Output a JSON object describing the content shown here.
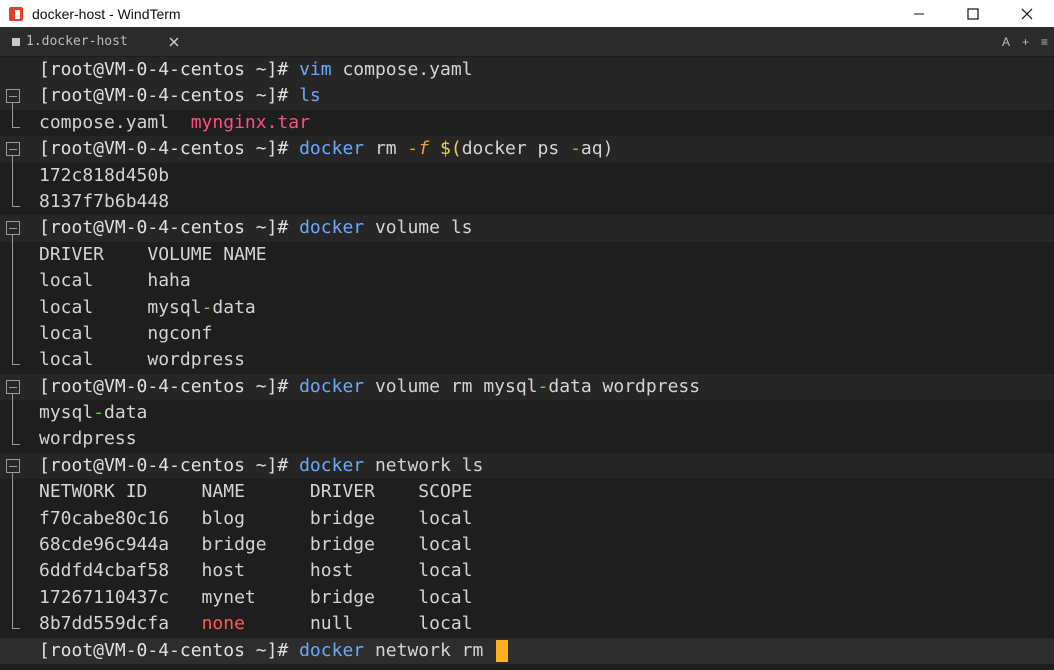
{
  "window": {
    "title": "docker-host - WindTerm",
    "brand_color": "#e0402b"
  },
  "tabs": [
    {
      "label": "1.docker-host"
    }
  ],
  "toolbar": {
    "font_label": "A",
    "add_label": "+",
    "menu_label": "≡"
  },
  "prompt": "[root@VM-0-4-centos ~]#",
  "lines": {
    "l1": {
      "cmd": "vim",
      "rest": " compose.yaml"
    },
    "l2": {
      "cmd": "ls"
    },
    "l3": {
      "a": "compose.yaml  ",
      "b": "mynginx.tar"
    },
    "l4": {
      "cmd": "docker",
      "rest1": " rm ",
      "flag": "-f",
      "sp": " ",
      "sub": "$(",
      "rest2": "docker ps ",
      "dash": "-",
      "rest3": "aq)"
    },
    "l5": "172c818d450b",
    "l6": "8137f7b6b448",
    "l7": {
      "cmd": "docker",
      "rest": " volume ls"
    },
    "l8": "DRIVER    VOLUME NAME",
    "l9": "local     haha",
    "l10": {
      "a": "local     mysql",
      "dash": "-",
      "b": "data"
    },
    "l11": "local     ngconf",
    "l12": "local     wordpress",
    "l13": {
      "cmd": "docker",
      "rest1": " volume rm mysql",
      "dash": "-",
      "rest2": "data wordpress"
    },
    "l14": {
      "a": "mysql",
      "dash": "-",
      "b": "data"
    },
    "l15": "wordpress",
    "l16": {
      "cmd": "docker",
      "rest": " network ls"
    },
    "l17": "NETWORK ID     NAME      DRIVER    SCOPE",
    "l18": "f70cabe80c16   blog      bridge    local",
    "l19": "68cde96c944a   bridge    bridge    local",
    "l20": "6ddfd4cbaf58   host      host      local",
    "l21": "17267110437c   mynet     bridge    local",
    "l22": {
      "a": "8b7dd559dcfa   ",
      "red": "none",
      "b": "      null      local"
    },
    "l23": {
      "cmd": "docker",
      "rest": " network rm "
    }
  }
}
